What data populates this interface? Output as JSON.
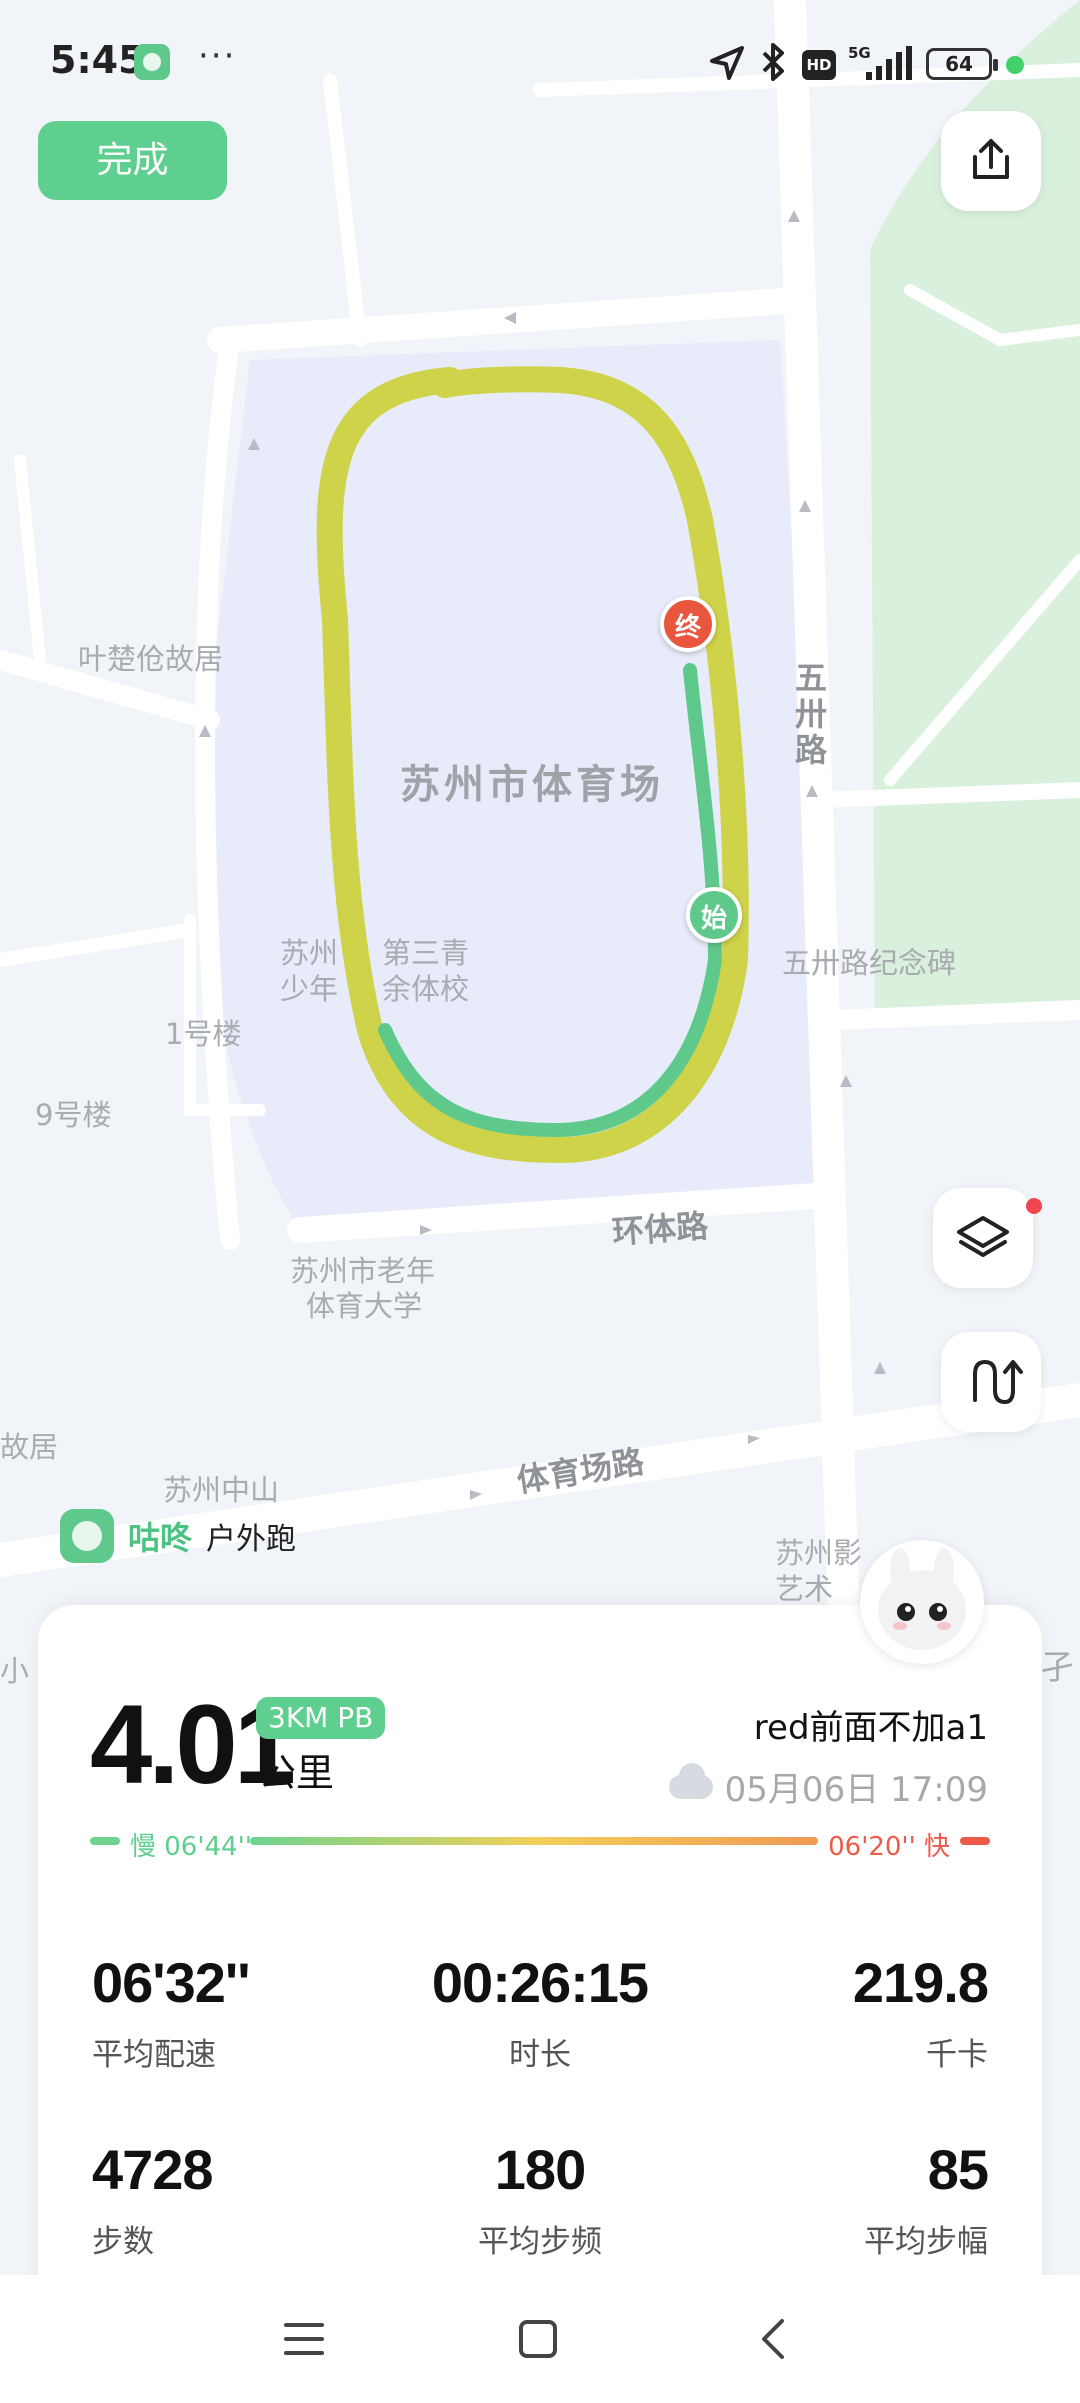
{
  "status_bar": {
    "time": "5:45",
    "more": "···",
    "network": "5G",
    "hd": "HD",
    "battery": "64"
  },
  "top": {
    "done_label": "完成"
  },
  "map": {
    "labels": {
      "stadium": "苏州市体育场",
      "ye_chucang": "叶楚伧故居",
      "wuzhou_road": "五卅路",
      "school_a": "苏州",
      "school_b": "第三青",
      "school_c": "少年",
      "school_d": "余体校",
      "building1": "1号楼",
      "building9": "9号楼",
      "monument": "五卅路纪念碑",
      "huanti_road": "环体路",
      "elder_uni_a": "苏州市老年",
      "elder_uni_b": "体育大学",
      "guju_edge": "故居",
      "zhongshan": "苏州中山",
      "tiyuchang_road": "体育场路",
      "film_a": "苏州影",
      "film_b": "艺术",
      "xiao_edge": "小",
      "zi_edge": "孑"
    },
    "pins": {
      "end": "终",
      "start": "始"
    }
  },
  "brand": {
    "name": "咕咚",
    "activity": "户外跑",
    "color": "#5fc98b"
  },
  "summary": {
    "distance": "4.01",
    "pb_badge": "3KM PB",
    "unit": "公里",
    "user": "red前面不加a1",
    "datetime": "05月06日 17:09",
    "pace_slow": "慢 06'44''",
    "pace_fast": "06'20'' 快"
  },
  "stats": [
    {
      "value": "06'32''",
      "label": "平均配速"
    },
    {
      "value": "00:26:15",
      "label": "时长"
    },
    {
      "value": "219.8",
      "label": "千卡"
    },
    {
      "value": "4728",
      "label": "步数"
    },
    {
      "value": "180",
      "label": "平均步频"
    },
    {
      "value": "85",
      "label": "平均步幅"
    }
  ],
  "colors": {
    "accent": "#5ecf8e",
    "track_yellow": "#cfd34a",
    "track_green": "#5fc98b",
    "end_pin": "#e8563e",
    "fast": "#ec5a4a"
  }
}
